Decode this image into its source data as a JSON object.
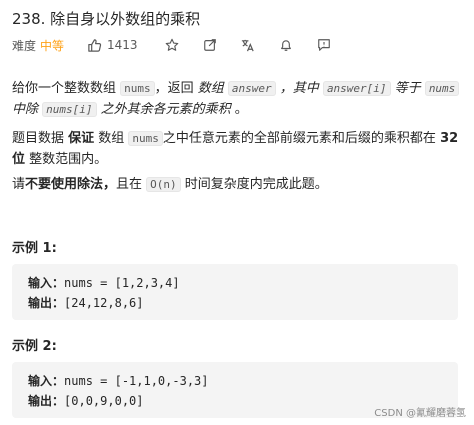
{
  "problem": {
    "title": "238. 除自身以外数组的乘积",
    "difficulty_label": "难度",
    "difficulty": "中等",
    "likes": "1413"
  },
  "icons": [
    "thumbs-up-icon",
    "star-icon",
    "share-icon",
    "translate-icon",
    "bell-icon",
    "feedback-icon"
  ],
  "description": {
    "p1": {
      "a": "给你一个整数数组 ",
      "code1": "nums",
      "b": "，返回 ",
      "c": "数组 ",
      "code2": "answer",
      "d": " ，其中 ",
      "code3": "answer[i]",
      "e": " 等于 ",
      "code4": "nums",
      "f": " 中除 ",
      "code5": "nums[i]",
      "g": " 之外其余各元素的乘积",
      "h": " 。"
    },
    "p2": {
      "a": "题目数据 ",
      "bold1": "保证",
      "b": " 数组 ",
      "code1": "nums",
      "c": "之中任意元素的全部前缀元素和后缀的乘积都在  ",
      "bold2": "32 位",
      "d": " 整数范围内。"
    },
    "p3": {
      "a": "请",
      "bold1": "不要使用除法，",
      "b": "且在 ",
      "code1": "O(n)",
      "c": " 时间复杂度内完成此题。"
    }
  },
  "examples": [
    {
      "title": "示例 1:",
      "input_label": "输入：",
      "input": "nums = [1,2,3,4]",
      "output_label": "输出：",
      "output": "[24,12,8,6]"
    },
    {
      "title": "示例 2:",
      "input_label": "输入：",
      "input": "nums = [-1,1,0,-3,3]",
      "output_label": "输出：",
      "output": "[0,0,9,0,0]"
    }
  ],
  "watermark": "CSDN @氰耀磨蓉氢"
}
